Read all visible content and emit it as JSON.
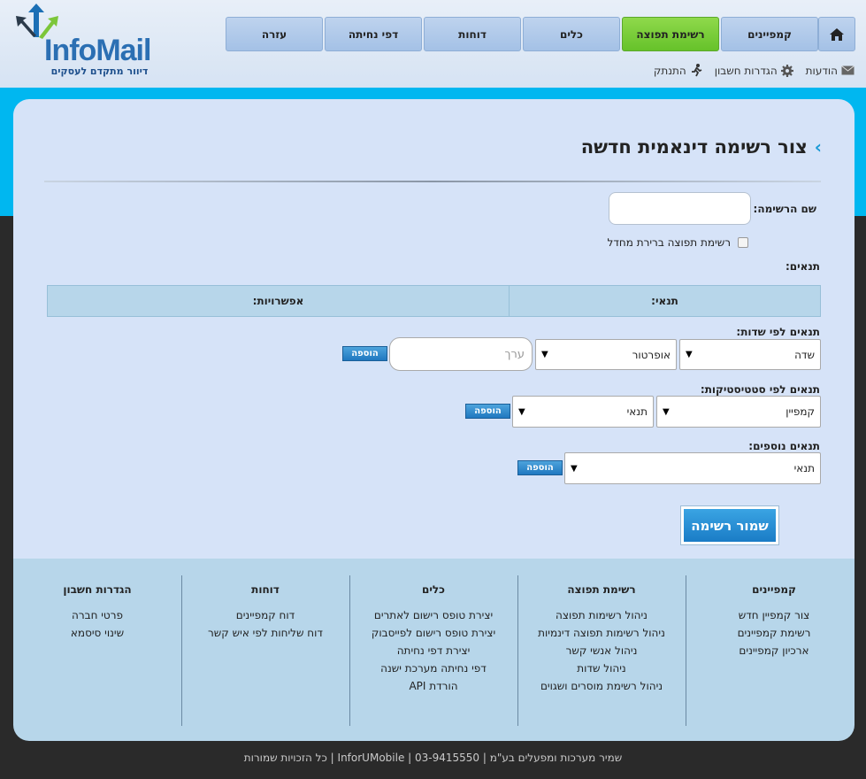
{
  "brand": {
    "logo_info": "Info",
    "logo_mail": "Mail",
    "tagline": "דיוור מתקדם לעסקים"
  },
  "nav": {
    "items": [
      {
        "label": "קמפיינים"
      },
      {
        "label": "רשימת תפוצה"
      },
      {
        "label": "כלים"
      },
      {
        "label": "דוחות"
      },
      {
        "label": "דפי נחיתה"
      },
      {
        "label": "עזרה"
      }
    ]
  },
  "util": {
    "messages": "הודעות",
    "settings": "הגדרות חשבון",
    "logout": "התנתק"
  },
  "page": {
    "title": "צור רשימה דינאמית חדשה",
    "list_name_label": "שם הרשימה:",
    "list_name_value": "",
    "default_checkbox_label": "רשימת תפוצה ברירת מחדל",
    "conditions_label": "תנאים:",
    "table": {
      "col_condition": "תנאי:",
      "col_options": "אפשרויות:"
    },
    "by_fields": {
      "label": "תנאים לפי שדות:",
      "field_select": "שדה",
      "operator_select": "אופרטור",
      "value_placeholder": "ערך",
      "add": "הוספה"
    },
    "by_stats": {
      "label": "תנאים לפי סטטיסטיקות:",
      "campaign_select": "קמפיין",
      "condition_select": "תנאי",
      "add": "הוספה"
    },
    "extra": {
      "label": "תנאים נוספים:",
      "condition_select": "תנאי",
      "add": "הוספה"
    },
    "save_button": "שמור רשימה"
  },
  "footer": {
    "columns": [
      {
        "heading": "קמפיינים",
        "links": [
          "צור קמפיין חדש",
          "רשימת קמפיינים",
          "ארכיון קמפיינים"
        ]
      },
      {
        "heading": "רשימת תפוצה",
        "links": [
          "ניהול רשימות תפוצה",
          "ניהול רשימות תפוצה דינמיות",
          "ניהול אנשי קשר",
          "ניהול שדות",
          "ניהול רשימת מוסרים ושגוים"
        ]
      },
      {
        "heading": "כלים",
        "links": [
          "יצירת טופס רישום לאתרים",
          "יצירת טופס רישום לפייסבוק",
          "יצירת דפי נחיתה",
          "דפי נחיתה מערכת ישנה",
          "הורדת API"
        ]
      },
      {
        "heading": "דוחות",
        "links": [
          "דוח קמפיינים",
          "דוח שליחות לפי איש קשר"
        ]
      },
      {
        "heading": "הגדרות חשבון",
        "links": [
          "פרטי חברה",
          "שינוי סיסמא"
        ]
      }
    ],
    "copyright": "שמיר מערכות ומפעלים בע\"מ | 03-9415550 | InforUMobile | כל הזכויות שמורות"
  },
  "colors": {
    "accent_blue": "#00b7f0",
    "nav_active_green": "#66c22a",
    "button_blue": "#1f78c0"
  }
}
